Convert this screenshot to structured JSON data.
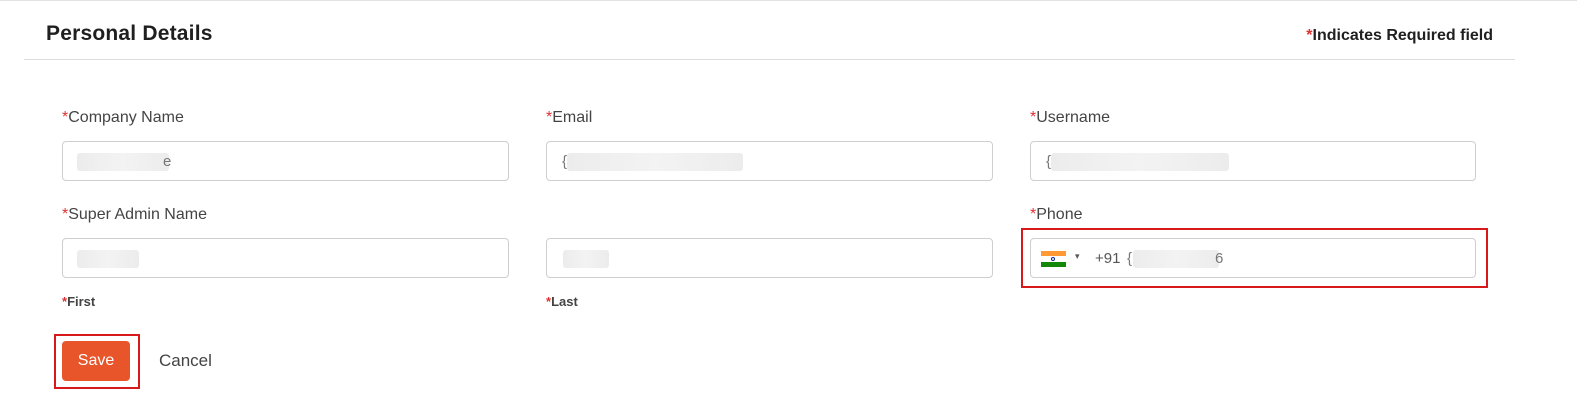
{
  "header": {
    "title": "Personal Details",
    "required_star": "*",
    "required_note": "Indicates Required field"
  },
  "form": {
    "required_star": "*",
    "company_name": {
      "label": "Company Name",
      "value_visible": "e"
    },
    "email": {
      "label": "Email",
      "value_visible": "{"
    },
    "username": {
      "label": "Username",
      "value_visible": "{"
    },
    "super_admin_name": {
      "label": "Super Admin Name"
    },
    "first_name": {
      "value_visible": "",
      "sub_label": "First"
    },
    "last_name": {
      "value_visible": "",
      "sub_label": "Last"
    },
    "phone": {
      "label": "Phone",
      "country_code": "+91 ",
      "value_visible_start": "{",
      "value_visible_end": "6",
      "flag_icon": "india-flag-icon",
      "caret": "▾"
    }
  },
  "actions": {
    "save_label": "Save",
    "cancel_label": "Cancel"
  },
  "colors": {
    "accent": "#e8552b",
    "required": "#e03131",
    "highlight": "#d7191c"
  }
}
